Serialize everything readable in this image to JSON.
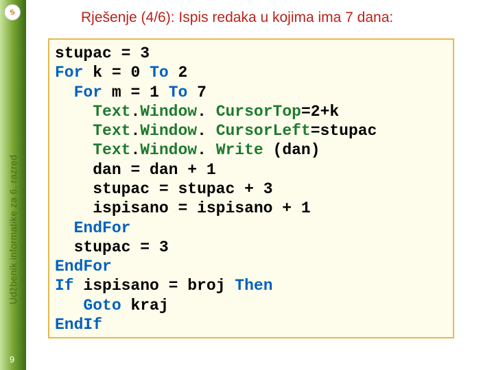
{
  "rail": {
    "label": "Udžbenik informatike za 6. razred"
  },
  "page_number": "9",
  "title": "Rješenje (4/6): Ispis redaka u kojima ima 7 dana:",
  "code": {
    "l1_a": "stupac ",
    "l1_eq": "=",
    "l1_b": " 3",
    "l2_a": "For",
    "l2_b": " k ",
    "l2_c": "=",
    "l2_d": " 0 ",
    "l2_e": "To",
    "l2_f": " 2",
    "l3_a": "For",
    "l3_b": " m ",
    "l3_c": "=",
    "l3_d": " 1 ",
    "l3_e": "To",
    "l3_f": " 7",
    "l4_a": "Text",
    "l4_dot": ".",
    "l4_b": "Window",
    "l4_c": ". ",
    "l4_d": "Cursor",
    "l4_e": "Top",
    "l4_eq": "=",
    "l4_f": "2",
    "l4_plus": "+",
    "l4_g": "k",
    "l5_a": "Text",
    "l5_b": "Window",
    "l5_c": ". ",
    "l5_d": "Cursor",
    "l5_e": "Left",
    "l5_eq": "=",
    "l5_f": "stupac",
    "l6_a": "Text",
    "l6_b": "Window",
    "l6_c": ". ",
    "l6_d": "Write ",
    "l6_e": "(",
    "l6_f": "dan",
    "l6_g": ")",
    "l7_a": "dan ",
    "l7_eq": "=",
    "l7_b": " dan ",
    "l7_plus": "+",
    "l7_c": " 1",
    "l8_a": "stupac ",
    "l8_eq": "=",
    "l8_b": " stupac ",
    "l8_plus": "+",
    "l8_c": " 3",
    "l9_a": "ispisano ",
    "l9_eq": "=",
    "l9_b": " ispisano ",
    "l9_plus": "+",
    "l9_c": " 1",
    "l10_a": "End",
    "l10_b": "For",
    "l11_a": "stupac ",
    "l11_eq": "=",
    "l11_b": " 3",
    "l12_a": "End",
    "l12_b": "For",
    "l13_a": "If",
    "l13_b": " ispisano ",
    "l13_c": "=",
    "l13_d": " broj ",
    "l13_e": "Then",
    "l14_a": "Goto",
    "l14_b": " kraj",
    "l15_a": "End",
    "l15_b": "If",
    "ind1": "  ",
    "ind2": "    ",
    "ind3": "   "
  }
}
